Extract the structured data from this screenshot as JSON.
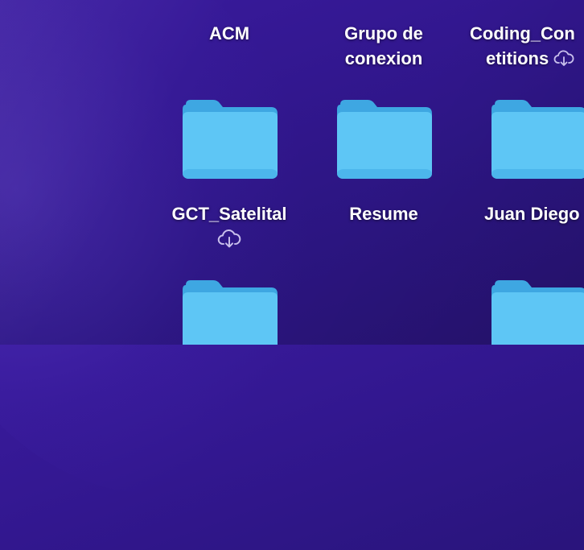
{
  "desktop": {
    "items": [
      {
        "label": "ACM"
      },
      {
        "label_line1": "Grupo de",
        "label_line2": "conexion"
      },
      {
        "label_line1": "Coding_Con",
        "label_line2": "etitions",
        "icon": "cloud-download-icon"
      },
      {
        "label": "GCT_Satelital",
        "icon": "cloud-download-icon"
      },
      {
        "label": "Resume"
      },
      {
        "label": "Juan Diego"
      }
    ]
  },
  "colors": {
    "folder_body": "#5ec6f5",
    "folder_tab": "#48b0e8",
    "background": "#30178c"
  }
}
